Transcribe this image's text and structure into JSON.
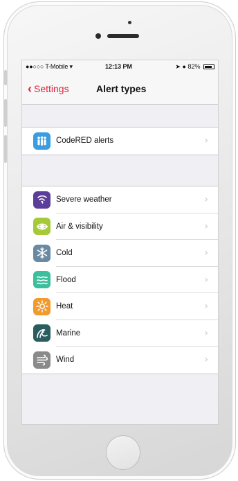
{
  "status_bar": {
    "carrier": "●●○○○ T-Mobile ",
    "time": "12:13 PM",
    "battery": "82%",
    "battery_level": 0.82
  },
  "nav": {
    "back_label": "Settings",
    "title": "Alert types"
  },
  "codered": {
    "label": "CodeRED alerts",
    "icon": "people-icon",
    "color": "#3a9de0"
  },
  "alerts": [
    {
      "label": "Severe weather",
      "icon": "tornado-icon",
      "color": "#5b3e99"
    },
    {
      "label": "Air & visibility",
      "icon": "eye-icon",
      "color": "#a6c93a"
    },
    {
      "label": "Cold",
      "icon": "snowflake-icon",
      "color": "#6a8aa3"
    },
    {
      "label": "Flood",
      "icon": "waves-icon",
      "color": "#3cbf9c"
    },
    {
      "label": "Heat",
      "icon": "sun-icon",
      "color": "#f29b2b"
    },
    {
      "label": "Marine",
      "icon": "wave-icon",
      "color": "#2a5d60"
    },
    {
      "label": "Wind",
      "icon": "wind-icon",
      "color": "#8a8a8a"
    }
  ],
  "colors": {
    "accent": "#e0243a",
    "background": "#efeff4"
  }
}
